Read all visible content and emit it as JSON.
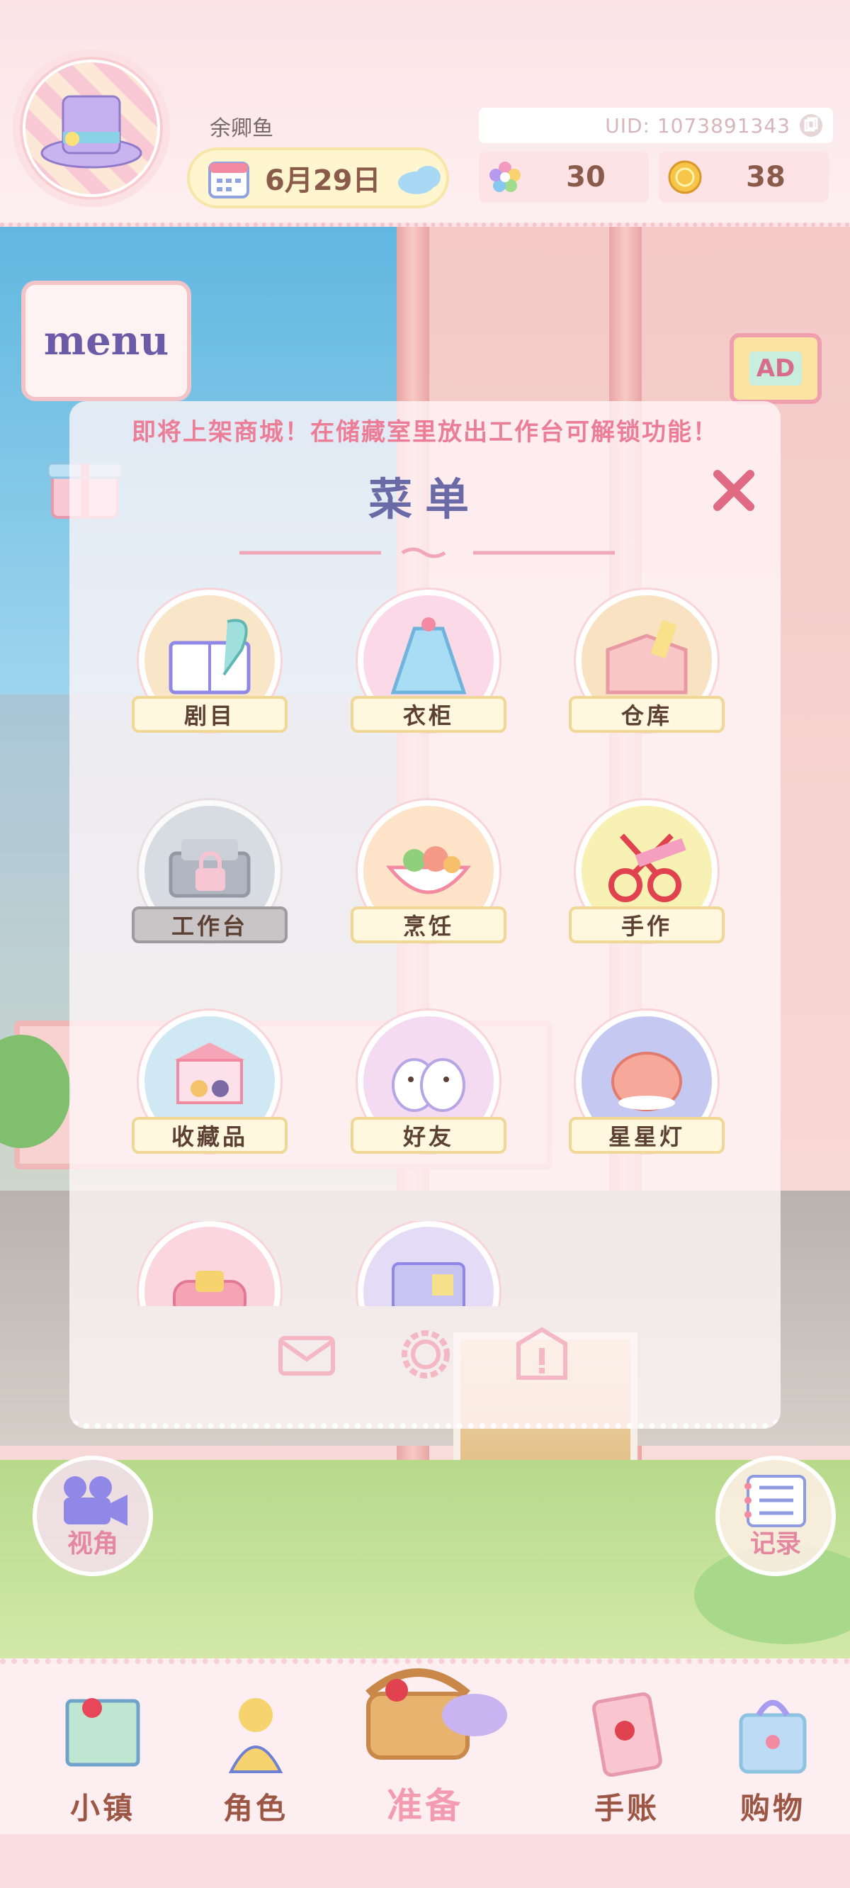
{
  "header": {
    "player_name": "余卿鱼",
    "date": "6月29日",
    "uid": "UID: 1073891343",
    "star_currency": "30",
    "coin_currency": "38"
  },
  "side": {
    "menu_label": "menu",
    "ad_label": "AD",
    "camera_label": "视角",
    "record_label": "记录"
  },
  "menu_panel": {
    "notice": "即将上架商城！在储藏室里放出工作台可解锁功能！",
    "title": "菜单",
    "items": [
      {
        "label": "剧目",
        "icon": "script-book-icon",
        "bg": "#f9e6c8",
        "locked": false
      },
      {
        "label": "衣柜",
        "icon": "wardrobe-dress-icon",
        "bg": "#fbd9e6",
        "locked": false
      },
      {
        "label": "仓库",
        "icon": "storage-box-icon",
        "bg": "#f9e2c2",
        "locked": false
      },
      {
        "label": "工作台",
        "icon": "workbench-icon",
        "bg": "#c8d8ea",
        "locked": true
      },
      {
        "label": "烹饪",
        "icon": "cooking-pot-icon",
        "bg": "#fde4c9",
        "locked": false
      },
      {
        "label": "手作",
        "icon": "scissors-icon",
        "bg": "#f7f1b3",
        "locked": false
      },
      {
        "label": "收藏品",
        "icon": "carousel-icon",
        "bg": "#cfe8f4",
        "locked": false
      },
      {
        "label": "好友",
        "icon": "friends-birds-icon",
        "bg": "#f4dbf1",
        "locked": false
      },
      {
        "label": "星星灯",
        "icon": "star-lamp-icon",
        "bg": "#c5c8f0",
        "locked": false
      },
      {
        "label": "",
        "icon": "sofa-icon",
        "bg": "#fbd6df",
        "locked": false
      },
      {
        "label": "",
        "icon": "notebook-icon",
        "bg": "#e4dcf6",
        "locked": false
      }
    ],
    "bottom_icons": [
      "mail-icon",
      "settings-gear-icon",
      "report-icon"
    ]
  },
  "bottom_nav": [
    {
      "label": "小镇",
      "icon": "town-map-icon"
    },
    {
      "label": "角色",
      "icon": "character-icon"
    },
    {
      "label": "准备",
      "icon": "picnic-basket-icon"
    },
    {
      "label": "手账",
      "icon": "journal-icon"
    },
    {
      "label": "购物",
      "icon": "shopping-bag-icon"
    }
  ],
  "colors": {
    "accent_pink": "#ec7d96",
    "title_purple": "#6a6aa6",
    "label_brown": "#5b4033",
    "nav_brown": "#9b5644"
  }
}
